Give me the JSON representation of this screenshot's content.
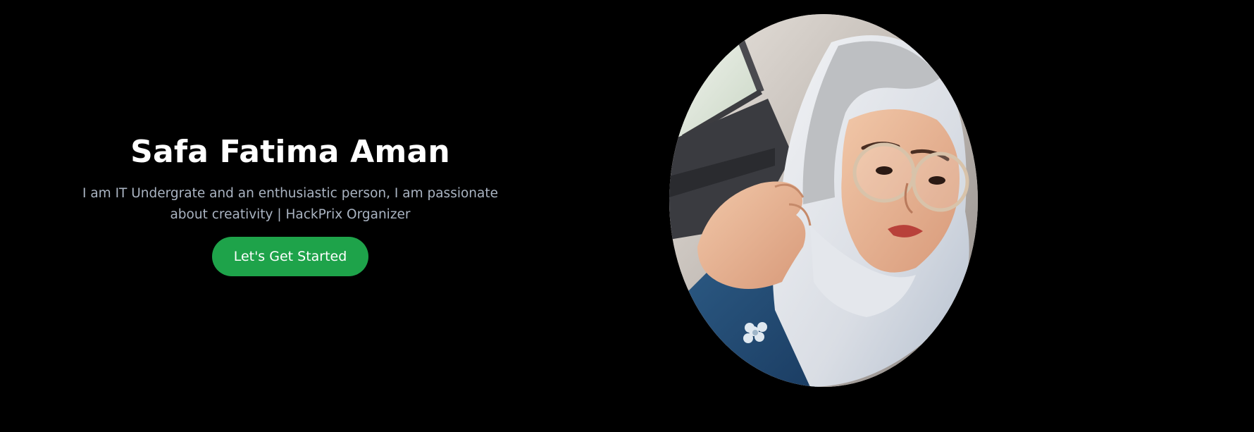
{
  "hero": {
    "name": "Safa Fatima Aman",
    "tagline": "I am IT Undergrate and an enthusiastic person, I am passionate about creativity | HackPrix Organizer",
    "cta_label": "Let's Get Started",
    "photo_alt": "Safa Fatima Aman"
  },
  "colors": {
    "background": "#000000",
    "heading": "#ffffff",
    "tagline": "#aab4c2",
    "cta": "#1ea34a"
  }
}
